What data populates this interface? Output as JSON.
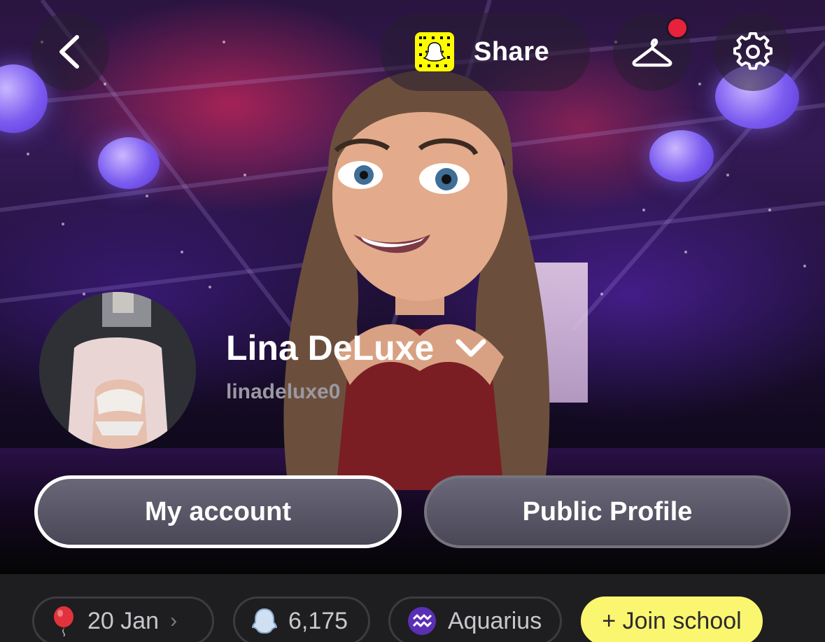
{
  "top_bar": {
    "share_label": "Share",
    "notification_color": "#e8213c",
    "snapcode_color": "#fffc00"
  },
  "profile": {
    "display_name": "Lina DeLuxe",
    "username": "linadeluxe0"
  },
  "actions": {
    "my_account": "My account",
    "public_profile": "Public Profile"
  },
  "info_chips": {
    "birthday": "20 Jan",
    "score": "6,175",
    "zodiac": "Aquarius",
    "join_school": "+ Join school"
  }
}
